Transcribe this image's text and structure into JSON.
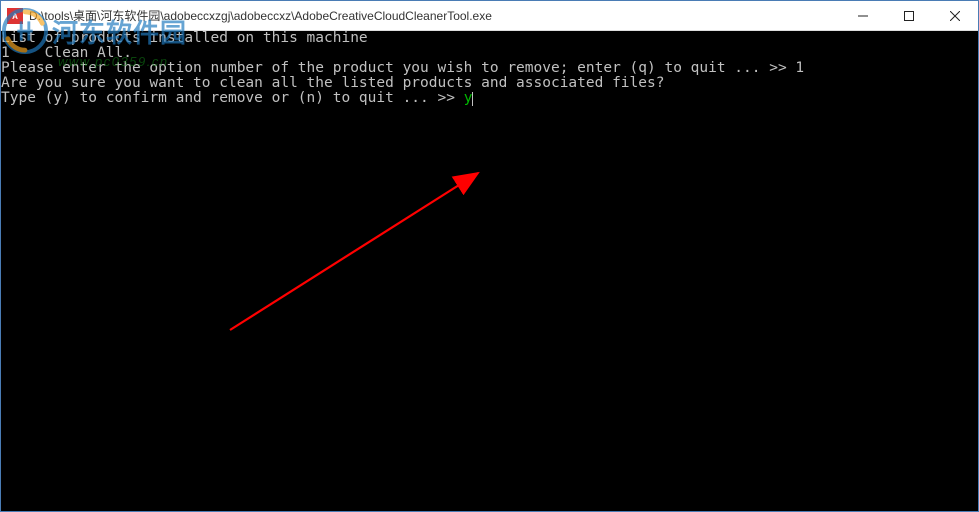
{
  "titlebar": {
    "path": "D:\\tools\\桌面\\河东软件园\\adobeccxzgj\\adobeccxz\\AdobeCreativeCloudCleanerTool.exe"
  },
  "watermark": {
    "text": "河东软件园",
    "url": "www.pc0359.cn"
  },
  "console": {
    "line1": "List of products installed on this machine",
    "line2": "",
    "line3": "1    Clean All.",
    "line4": "",
    "line5": "Please enter the option number of the product you wish to remove; enter (q) to quit ... >> 1",
    "line6": "",
    "line7": "Are you sure you want to clean all the listed products and associated files?",
    "line8a": "Type (y) to confirm and remove or (n) to quit ... >> ",
    "line8b": "y"
  }
}
